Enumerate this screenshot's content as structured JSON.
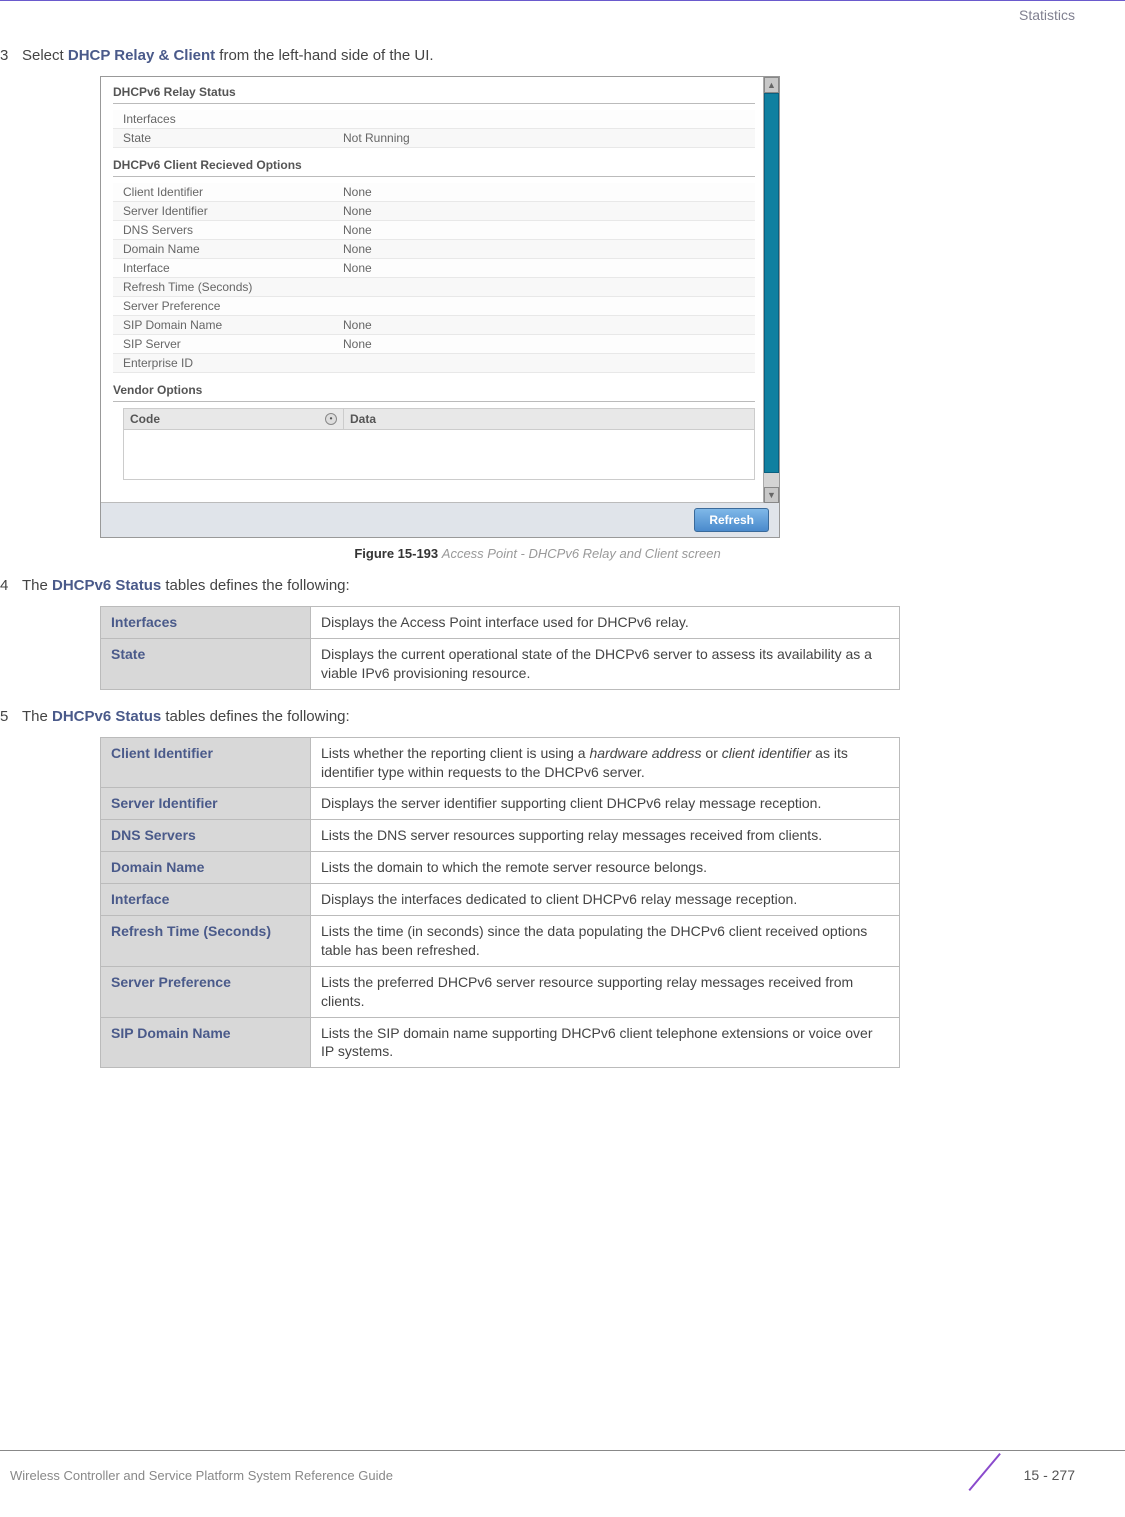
{
  "header": {
    "section": "Statistics"
  },
  "step3": {
    "num": "3",
    "prefix": "Select ",
    "bold": "DHCP Relay & Client",
    "suffix": " from the left-hand side of the UI."
  },
  "screenshot": {
    "sec1_title": "DHCPv6 Relay Status",
    "relay_rows": [
      {
        "k": "Interfaces",
        "v": ""
      },
      {
        "k": "State",
        "v": "Not Running"
      }
    ],
    "sec2_title": "DHCPv6 Client Recieved Options",
    "client_rows": [
      {
        "k": "Client Identifier",
        "v": "None"
      },
      {
        "k": "Server Identifier",
        "v": "None"
      },
      {
        "k": "DNS Servers",
        "v": "None"
      },
      {
        "k": "Domain Name",
        "v": "None"
      },
      {
        "k": "Interface",
        "v": "None"
      },
      {
        "k": "Refresh Time (Seconds)",
        "v": ""
      },
      {
        "k": "Server Preference",
        "v": ""
      },
      {
        "k": "SIP Domain Name",
        "v": "None"
      },
      {
        "k": "SIP Server",
        "v": "None"
      },
      {
        "k": "Enterprise ID",
        "v": ""
      }
    ],
    "sec3_title": "Vendor Options",
    "vendor_cols": {
      "c1": "Code",
      "c2": "Data"
    },
    "refresh": "Refresh"
  },
  "figure": {
    "num": "Figure 15-193",
    "caption": "Access Point - DHCPv6 Relay and Client screen"
  },
  "step4": {
    "num": "4",
    "prefix": "The ",
    "bold": "DHCPv6 Status",
    "suffix": " tables defines the following:"
  },
  "table1": [
    {
      "term": "Interfaces",
      "desc": "Displays the Access Point interface used for DHCPv6 relay."
    },
    {
      "term": "State",
      "desc": "Displays the current operational state of the DHCPv6 server to assess its availability as a viable IPv6 provisioning resource."
    }
  ],
  "step5": {
    "num": "5",
    "prefix": "The ",
    "bold": "DHCPv6 Status",
    "suffix": " tables defines the following:"
  },
  "table2": [
    {
      "term": "Client Identifier",
      "desc_pre": "Lists whether the reporting client is using a ",
      "it1": "hardware address",
      "mid": " or ",
      "it2": "client identifier",
      "desc_post": " as its identifier type within requests to the DHCPv6 server."
    },
    {
      "term": "Server Identifier",
      "desc": "Displays the server identifier supporting client DHCPv6 relay message reception."
    },
    {
      "term": "DNS Servers",
      "desc": "Lists the DNS server resources supporting relay messages received from clients."
    },
    {
      "term": "Domain Name",
      "desc": "Lists the domain to which the remote server resource belongs."
    },
    {
      "term": "Interface",
      "desc": "Displays the interfaces dedicated to client DHCPv6 relay message reception."
    },
    {
      "term": "Refresh Time (Seconds)",
      "desc": "Lists the time (in seconds) since the data populating the DHCPv6 client received options table has been refreshed."
    },
    {
      "term": "Server Preference",
      "desc": "Lists the preferred DHCPv6 server resource supporting relay messages received from clients."
    },
    {
      "term": "SIP Domain Name",
      "desc": "Lists the SIP domain name supporting DHCPv6 client telephone extensions or voice over IP systems."
    }
  ],
  "footer": {
    "left": "Wireless Controller and Service Platform System Reference Guide",
    "right": "15 - 277"
  }
}
